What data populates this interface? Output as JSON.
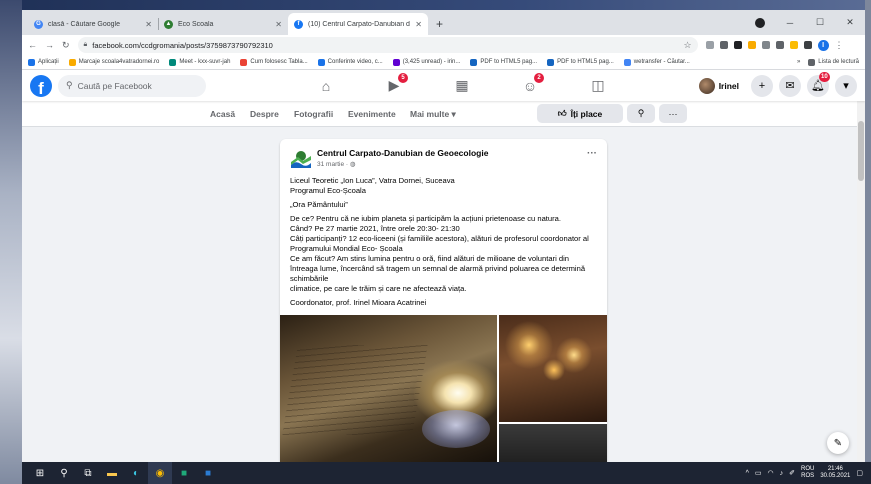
{
  "browser": {
    "tabs": [
      {
        "title": "clasă - Căutare Google",
        "favicon": "google-icon",
        "color": "#4285f4",
        "active": false
      },
      {
        "title": "Eco Scoala",
        "favicon": "eco-scoala-icon",
        "color": "#2e7d32",
        "active": false
      },
      {
        "title": "(10) Centrul Carpato-Danubian d",
        "favicon": "facebook-icon",
        "color": "#1877f2",
        "active": true
      }
    ],
    "new_tab": "+",
    "url": "facebook.com/ccdgromania/posts/3759873790792310",
    "bookmarks": [
      {
        "label": "Aplicații",
        "color": "#5f6368"
      },
      {
        "label": "Marcaje scoala4vatradornei.ro",
        "color": "#f9ab00"
      },
      {
        "label": "Meet - kxx-suvr-jah",
        "color": "#00897b"
      },
      {
        "label": "Cum folosesc Tabla...",
        "color": "#ea4335"
      },
      {
        "label": "Conferinte video, c...",
        "color": "#1a73e8"
      },
      {
        "label": "(3,425 unread) - irin...",
        "color": "#6001d2"
      },
      {
        "label": "PDF to HTML5 pag...",
        "color": "#1565c0"
      },
      {
        "label": "PDF to HTML5 pag...",
        "color": "#1565c0"
      },
      {
        "label": "wetransfer - Căutar...",
        "color": "#4285f4"
      }
    ],
    "bookmarks_more": "»",
    "reading_list": "Lista de lectură",
    "profile_initial": "I"
  },
  "facebook": {
    "search_placeholder": "Caută pe Facebook",
    "nav_badges": {
      "watch": "5",
      "groups": "2"
    },
    "user_name": "Irinel",
    "notifications_badge": "10",
    "page_tabs": [
      "Acasă",
      "Despre",
      "Fotografii",
      "Evenimente",
      "Mai multe ▾"
    ],
    "like_button": "Îți place",
    "post": {
      "author": "Centrul Carpato-Danubian de Geoecologie",
      "date": "31 martie · ",
      "paragraphs": [
        "Liceul Teoretic „Ion Luca”, Vatra Dornei, Suceava\nProgramul Eco-Școala",
        "„Ora Pământului”",
        "De ce? Pentru că ne iubim planeta și participăm la acțiuni prietenoase cu natura.\nCând? Pe 27 martie 2021, între orele 20:30- 21:30\nCâți participanți? 12 eco-liceeni (și familiile acestora), alături de profesorul coordonator al Programului Mondial Eco- Școala\nCe am făcut? Am stins lumina pentru o oră, fiind alături de milioane de voluntari din întreaga lume, încercând să tragem un semnal de alarmă privind poluarea ce determină schimbările\nclimatice, pe care le trăim și care ne afectează viața.",
        "Coordonator, prof. Irinel Mioara Acatrinei"
      ]
    }
  },
  "taskbar": {
    "tray_lang": "ROU\nROS",
    "time": "21:46",
    "date": "30.05.2021"
  }
}
